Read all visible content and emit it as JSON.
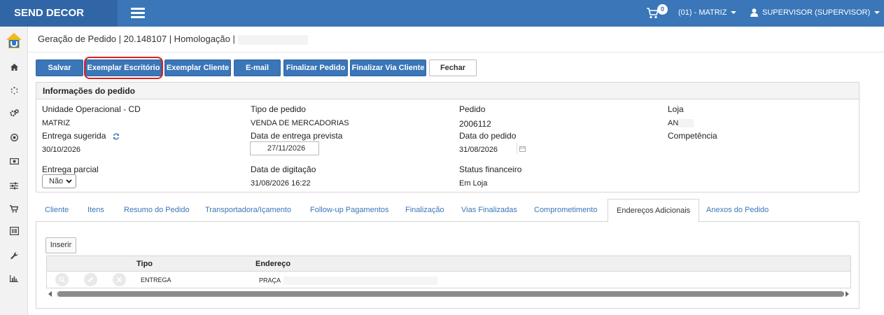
{
  "app": {
    "brand": "SEND DECOR"
  },
  "topbar": {
    "cart_count": "0",
    "store": "(01) - MATRIZ",
    "user": "SUPERVISOR (SUPERVISOR)"
  },
  "sidebar": {
    "items": [
      {
        "icon": "home-icon"
      },
      {
        "icon": "spinner-icon"
      },
      {
        "icon": "cogs-icon"
      },
      {
        "icon": "target-icon"
      },
      {
        "icon": "money-icon"
      },
      {
        "icon": "sliders-icon"
      },
      {
        "icon": "cart-icon"
      },
      {
        "icon": "barcode-icon"
      },
      {
        "icon": "wrench-icon"
      },
      {
        "icon": "bar-chart-icon"
      }
    ]
  },
  "breadcrumb": "Geração de Pedido | 20.148107 | Homologação |",
  "toolbar": {
    "salvar": "Salvar",
    "exemplar_escritorio": "Exemplar Escritório",
    "exemplar_cliente": "Exemplar Cliente",
    "email": "E-mail",
    "finalizar_pedido": "Finalizar Pedido",
    "finalizar_via_cliente": "Finalizar Via Cliente",
    "fechar": "Fechar"
  },
  "order_info": {
    "title": "Informações do pedido",
    "unidade_label": "Unidade Operacional - CD",
    "unidade_value": "MATRIZ",
    "tipo_label": "Tipo de pedido",
    "tipo_value": "VENDA DE MERCADORIAS",
    "pedido_label": "Pedido",
    "pedido_value": "2006112",
    "loja_label": "Loja",
    "loja_value": "AN",
    "entrega_sugerida_label": "Entrega sugerida",
    "entrega_sugerida_value": "30/10/2026",
    "entrega_prevista_label": "Data de entrega prevista",
    "entrega_prevista_value": "27/11/2026",
    "data_pedido_label": "Data do pedido",
    "data_pedido_value": "31/08/2026",
    "competencia_label": "Competência",
    "entrega_parcial_label": "Entrega parcial",
    "entrega_parcial_value": "Não",
    "data_digitacao_label": "Data de digitação",
    "data_digitacao_value": "31/08/2026 16:22",
    "status_financeiro_label": "Status financeiro",
    "status_financeiro_value": "Em Loja"
  },
  "tabs": [
    {
      "label": "Cliente"
    },
    {
      "label": "Itens"
    },
    {
      "label": "Resumo do Pedido"
    },
    {
      "label": "Transportadora/Içamento"
    },
    {
      "label": "Follow-up Pagamentos"
    },
    {
      "label": "Finalização"
    },
    {
      "label": "Vias Finalizadas"
    },
    {
      "label": "Comprometimento"
    },
    {
      "label": "Endereços Adicionais",
      "active": true
    },
    {
      "label": "Anexos do Pedido"
    }
  ],
  "addresses": {
    "insert_label": "Inserir",
    "columns": [
      "Tipo",
      "Endereço"
    ],
    "rows": [
      {
        "tipo": "ENTREGA",
        "endereco": "PRAÇA"
      }
    ]
  }
}
